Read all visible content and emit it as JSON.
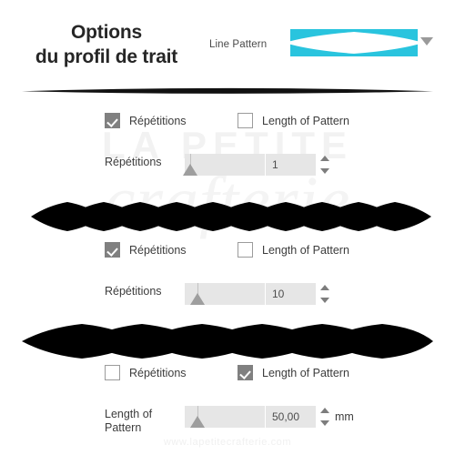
{
  "header": {
    "title_line1": "Options",
    "title_line2": "du profil de trait",
    "line_pattern_label": "Line Pattern",
    "swatch_icon": "diamond-pattern-swatch",
    "swatch_color": "#29c4de",
    "swatch_shape_color": "#ffffff",
    "dropdown_icon": "chevron-down-icon"
  },
  "watermarks": {
    "brand_line1": "LA PETITE",
    "brand_line2": "crafterie",
    "url": "www.lapetitecrafterie.com"
  },
  "groups": [
    {
      "checkbox_repetitions": {
        "label": "Répétitions",
        "checked": true,
        "icon": "checkmark-icon"
      },
      "checkbox_length": {
        "label": "Length of Pattern",
        "checked": false
      },
      "field": {
        "label": "Répétitions",
        "value": "1",
        "unit": "",
        "slider_percent": 6,
        "spinner_up_icon": "caret-up-icon",
        "spinner_down_icon": "caret-down-icon"
      }
    },
    {
      "checkbox_repetitions": {
        "label": "Répétitions",
        "checked": true,
        "icon": "checkmark-icon"
      },
      "checkbox_length": {
        "label": "Length of Pattern",
        "checked": false
      },
      "field": {
        "label": "Répétitions",
        "value": "10",
        "unit": "",
        "slider_percent": 14,
        "spinner_up_icon": "caret-up-icon",
        "spinner_down_icon": "caret-down-icon"
      }
    },
    {
      "checkbox_repetitions": {
        "label": "Répétitions",
        "checked": false
      },
      "checkbox_length": {
        "label": "Length of Pattern",
        "checked": true,
        "icon": "checkmark-icon"
      },
      "field": {
        "label": "Length of Pattern",
        "value": "50,00",
        "unit": "mm",
        "slider_percent": 14,
        "spinner_up_icon": "caret-up-icon",
        "spinner_down_icon": "caret-down-icon"
      }
    }
  ],
  "previews": [
    {
      "name": "diamond-pattern-10",
      "diamond_count": 10,
      "color": "#000000"
    },
    {
      "name": "diamond-pattern-6",
      "diamond_count": 6,
      "color": "#000000"
    }
  ]
}
